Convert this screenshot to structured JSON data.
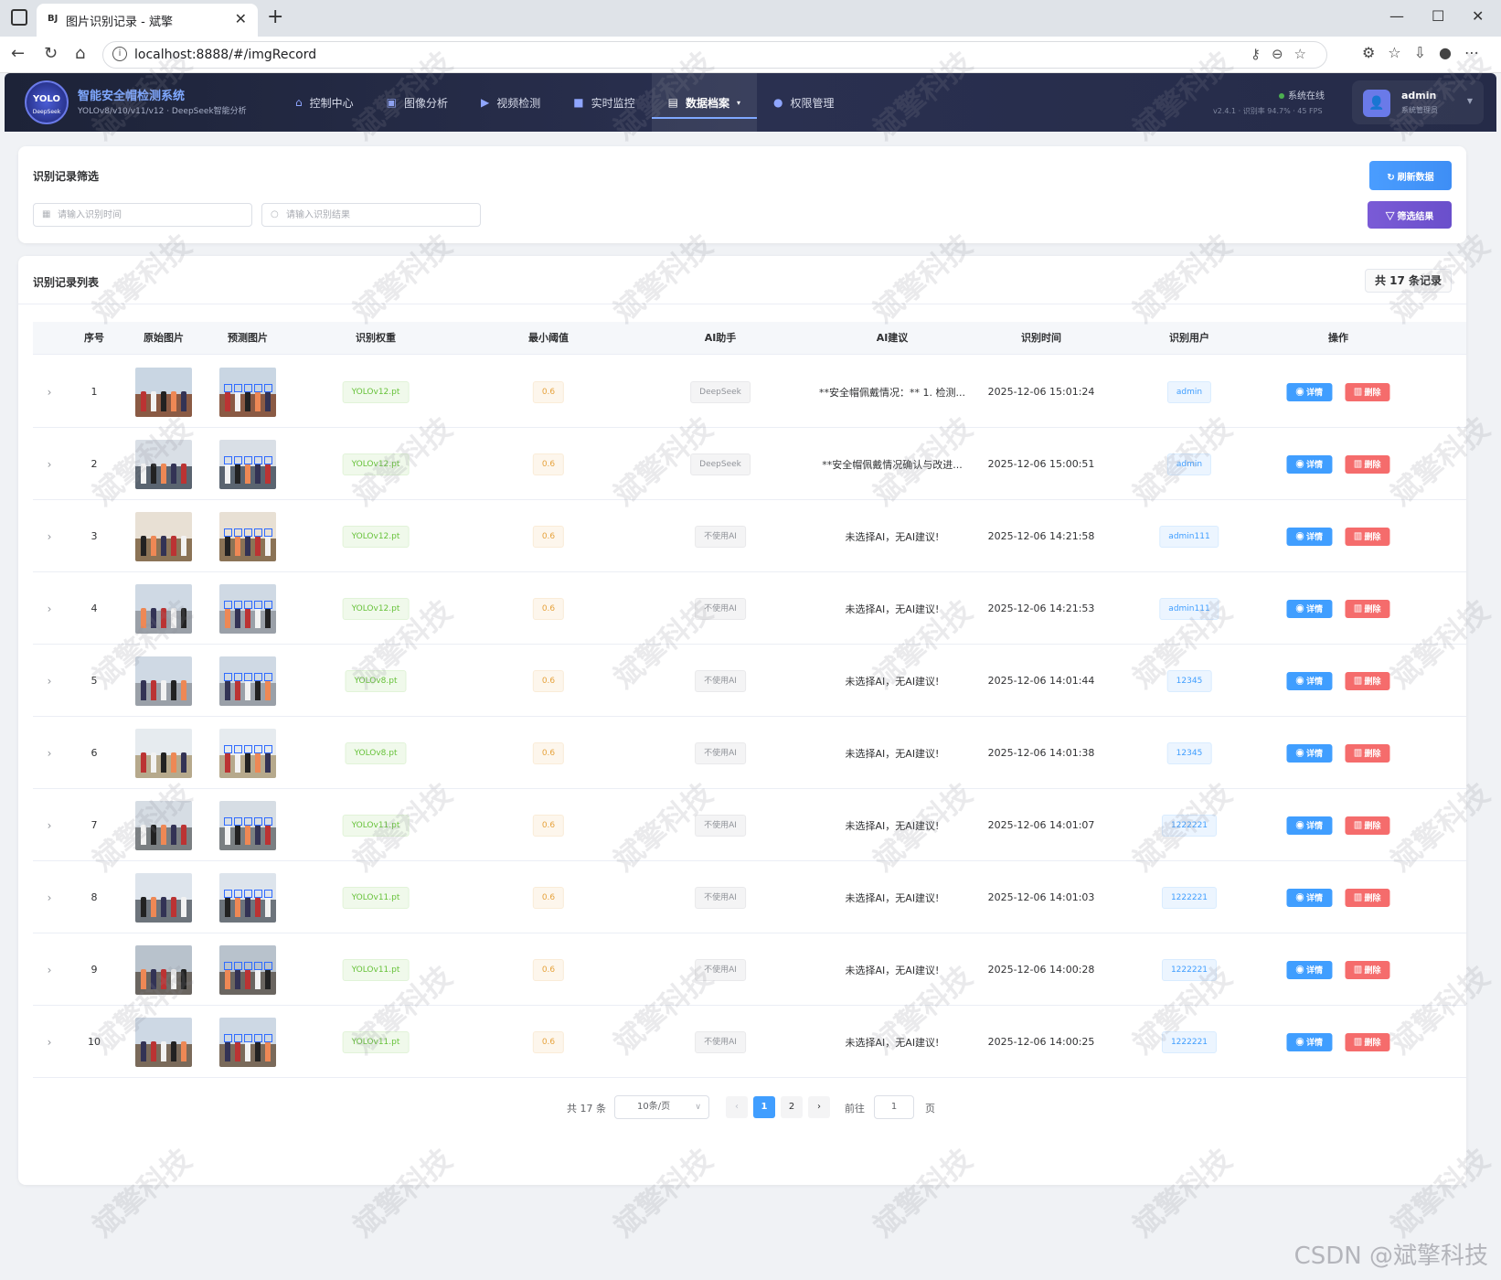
{
  "browser": {
    "tab_favicon": "BJ",
    "tab_title": "图片识别记录 - 斌擎",
    "url": "localhost:8888/#/imgRecord"
  },
  "header": {
    "logo_text": "YOLO",
    "logo_sub": "DeepSeek",
    "title": "智能安全帽检测系统",
    "subtitle": "YOLOv8/v10/v11/v12 · DeepSeek智能分析",
    "nav": [
      {
        "label": "控制中心",
        "icon": "home-icon"
      },
      {
        "label": "图像分析",
        "icon": "image-icon"
      },
      {
        "label": "视频检测",
        "icon": "video-icon"
      },
      {
        "label": "实时监控",
        "icon": "camera-icon"
      },
      {
        "label": "数据档案",
        "icon": "document-icon",
        "active": true
      },
      {
        "label": "权限管理",
        "icon": "user-icon"
      }
    ],
    "status": "系统在线",
    "version": "v2.4.1 · 识别率 94.7% · 45 FPS",
    "user_name": "admin",
    "user_role": "系统管理员"
  },
  "filter": {
    "title": "识别记录筛选",
    "time_placeholder": "请输入识别时间",
    "result_placeholder": "请输入识别结果",
    "refresh_label": "刷新数据",
    "filter_label": "筛选结果"
  },
  "list": {
    "title": "识别记录列表",
    "total_badge": "共 17 条记录",
    "columns": [
      "序号",
      "原始图片",
      "预测图片",
      "识别权重",
      "最小阈值",
      "AI助手",
      "AI建议",
      "识别时间",
      "识别用户",
      "操作"
    ],
    "detail_label": "详情",
    "delete_label": "删除",
    "rows": [
      {
        "index": "1",
        "weight": "YOLOv12.pt",
        "threshold": "0.6",
        "ai": "DeepSeek",
        "advice": "**安全帽佩戴情况：** 1. 检测...",
        "time": "2025-12-06 15:01:24",
        "user": "admin"
      },
      {
        "index": "2",
        "weight": "YOLOv12.pt",
        "threshold": "0.6",
        "ai": "DeepSeek",
        "advice": "**安全帽佩戴情况确认与改进...",
        "time": "2025-12-06 15:00:51",
        "user": "admin"
      },
      {
        "index": "3",
        "weight": "YOLOv12.pt",
        "threshold": "0.6",
        "ai": "不使用AI",
        "advice": "未选择AI，无AI建议!",
        "time": "2025-12-06 14:21:58",
        "user": "admin111"
      },
      {
        "index": "4",
        "weight": "YOLOv12.pt",
        "threshold": "0.6",
        "ai": "不使用AI",
        "advice": "未选择AI，无AI建议!",
        "time": "2025-12-06 14:21:53",
        "user": "admin111"
      },
      {
        "index": "5",
        "weight": "YOLOv8.pt",
        "threshold": "0.6",
        "ai": "不使用AI",
        "advice": "未选择AI，无AI建议!",
        "time": "2025-12-06 14:01:44",
        "user": "12345"
      },
      {
        "index": "6",
        "weight": "YOLOv8.pt",
        "threshold": "0.6",
        "ai": "不使用AI",
        "advice": "未选择AI，无AI建议!",
        "time": "2025-12-06 14:01:38",
        "user": "12345"
      },
      {
        "index": "7",
        "weight": "YOLOv11.pt",
        "threshold": "0.6",
        "ai": "不使用AI",
        "advice": "未选择AI，无AI建议!",
        "time": "2025-12-06 14:01:07",
        "user": "1222221"
      },
      {
        "index": "8",
        "weight": "YOLOv11.pt",
        "threshold": "0.6",
        "ai": "不使用AI",
        "advice": "未选择AI，无AI建议!",
        "time": "2025-12-06 14:01:03",
        "user": "1222221"
      },
      {
        "index": "9",
        "weight": "YOLOv11.pt",
        "threshold": "0.6",
        "ai": "不使用AI",
        "advice": "未选择AI，无AI建议!",
        "time": "2025-12-06 14:00:28",
        "user": "1222221"
      },
      {
        "index": "10",
        "weight": "YOLOv11.pt",
        "threshold": "0.6",
        "ai": "不使用AI",
        "advice": "未选择AI，无AI建议!",
        "time": "2025-12-06 14:00:25",
        "user": "1222221"
      }
    ]
  },
  "pagination": {
    "total": "共 17 条",
    "page_size": "10条/页",
    "pages": [
      "1",
      "2"
    ],
    "current": "1",
    "goto_label": "前往",
    "goto_value": "1",
    "page_unit": "页"
  },
  "watermark": "斌擎科技",
  "footer_mark": "CSDN @斌擎科技"
}
